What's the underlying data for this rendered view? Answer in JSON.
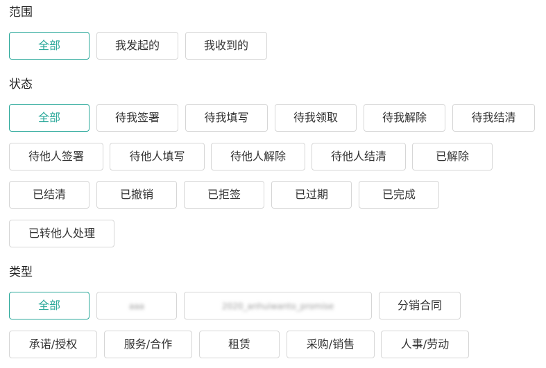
{
  "scope": {
    "title": "范围",
    "options": [
      "全部",
      "我发起的",
      "我收到的"
    ],
    "selected": "全部"
  },
  "status": {
    "title": "状态",
    "options": [
      "全部",
      "待我签署",
      "待我填写",
      "待我领取",
      "待我解除",
      "待我结清",
      "待他人签署",
      "待他人填写",
      "待他人解除",
      "待他人结清",
      "已解除",
      "已结清",
      "已撤销",
      "已拒签",
      "已过期",
      "已完成",
      "已转他人处理"
    ],
    "selected": "全部"
  },
  "type": {
    "title": "类型",
    "options": [
      "全部",
      "aaa",
      "2020_anhuiwanto_promise",
      "分销合同",
      "承诺/授权",
      "服务/合作",
      "租赁",
      "采购/销售",
      "人事/劳动"
    ],
    "selected": "全部"
  },
  "colors": {
    "accent": "#2aa89a",
    "border": "#d6d6d6",
    "text": "#333333"
  }
}
